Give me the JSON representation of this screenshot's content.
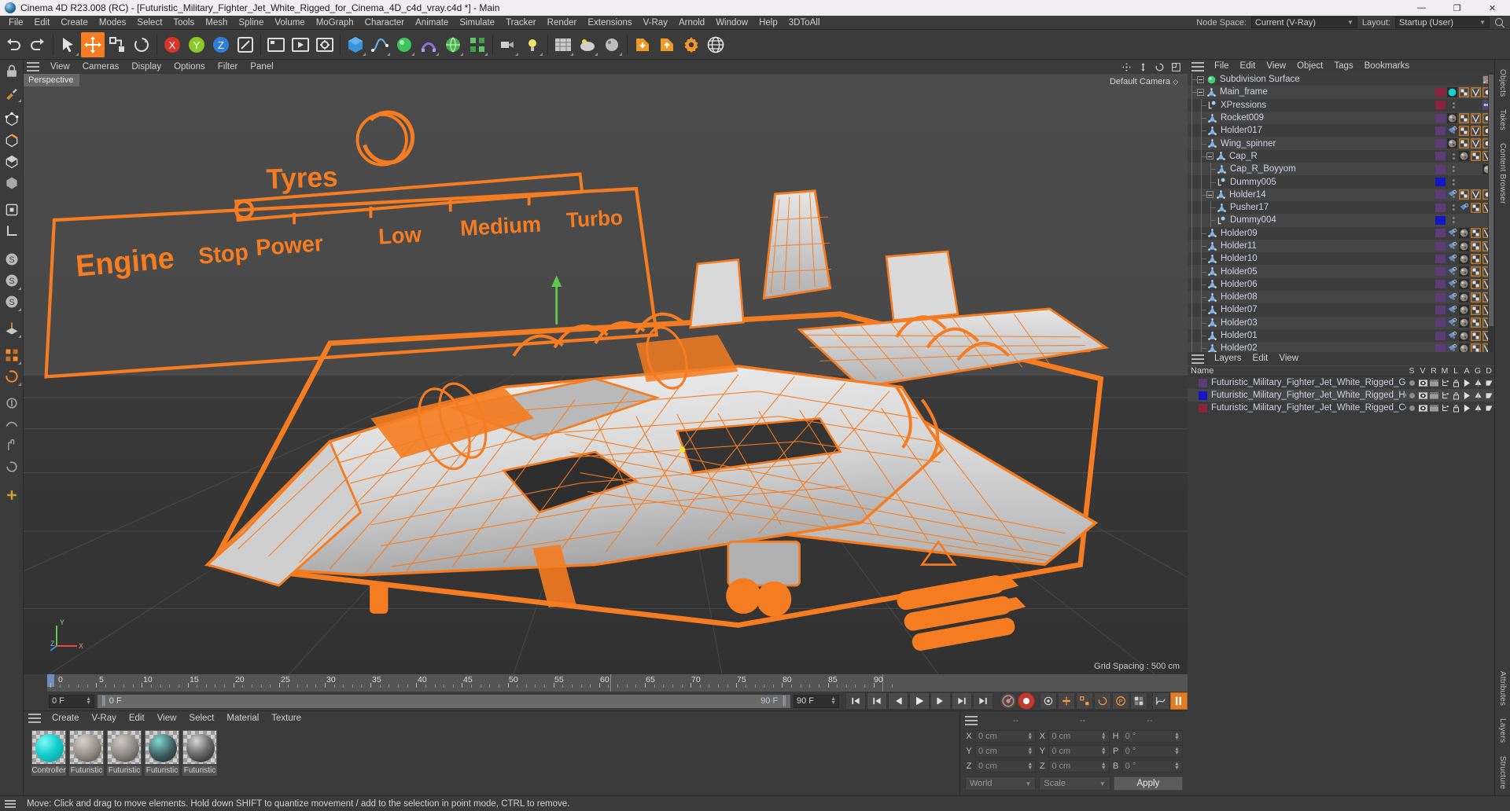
{
  "window": {
    "title": "Cinema 4D R23.008 (RC) - [Futuristic_Military_Fighter_Jet_White_Rigged_for_Cinema_4D_c4d_vray.c4d *] - Main",
    "minimize": "—",
    "maximize": "❐",
    "close": "✕"
  },
  "menubar": {
    "items": [
      "File",
      "Edit",
      "Create",
      "Modes",
      "Select",
      "Tools",
      "Mesh",
      "Spline",
      "Volume",
      "MoGraph",
      "Character",
      "Animate",
      "Simulate",
      "Tracker",
      "Render",
      "Extensions",
      "V-Ray",
      "Arnold",
      "Window",
      "Help",
      "3DToAll"
    ],
    "node_space_label": "Node Space:",
    "node_space_value": "Current (V-Ray)",
    "layout_label": "Layout:",
    "layout_value": "Startup (User)"
  },
  "viewport": {
    "menu": [
      "View",
      "Cameras",
      "Display",
      "Options",
      "Filter",
      "Panel"
    ],
    "perspective_label": "Perspective",
    "camera_label": "Default Camera",
    "grid_spacing": "Grid Spacing : 500 cm",
    "hud": {
      "tyres": "Tyres",
      "engine": "Engine",
      "stop": "Stop",
      "power": "Power",
      "low": "Low",
      "medium": "Medium",
      "turbo": "Turbo"
    },
    "axis": {
      "x": "X",
      "y": "Y",
      "z": "Z"
    }
  },
  "timeline": {
    "labels": [
      "0",
      "5",
      "10",
      "15",
      "20",
      "25",
      "30",
      "35",
      "40",
      "45",
      "50",
      "55",
      "60",
      "65",
      "70",
      "75",
      "80",
      "85",
      "90"
    ],
    "current_frame": "0 F",
    "preview_start": "0 F",
    "preview_end": "90 F",
    "end_frame": "90 F",
    "right_frame": "0 F"
  },
  "materials": {
    "menu": [
      "Create",
      "V-Ray",
      "Edit",
      "View",
      "Select",
      "Material",
      "Texture"
    ],
    "items": [
      {
        "name": "Controller",
        "color": "#19d3d3"
      },
      {
        "name": "Futuristic",
        "color": "#9a9289"
      },
      {
        "name": "Futuristic",
        "color": "#8e8b86"
      },
      {
        "name": "Futuristic",
        "color": "#4b5a5c"
      },
      {
        "name": "Futuristic",
        "color": "#6f6f6f"
      }
    ]
  },
  "coordinates": {
    "header_dashes": [
      "--",
      "--",
      "--"
    ],
    "rows": [
      {
        "pos_label": "X",
        "pos_value": "0 cm",
        "size_label": "X",
        "size_value": "0 cm",
        "rot_label": "H",
        "rot_value": "0 °"
      },
      {
        "pos_label": "Y",
        "pos_value": "0 cm",
        "size_label": "Y",
        "size_value": "0 cm",
        "rot_label": "P",
        "rot_value": "0 °"
      },
      {
        "pos_label": "Z",
        "pos_value": "0 cm",
        "size_label": "Z",
        "size_value": "0 cm",
        "rot_label": "B",
        "rot_value": "0 °"
      }
    ],
    "system": "World",
    "mode": "Scale",
    "apply": "Apply"
  },
  "object_manager": {
    "menu": [
      "File",
      "Edit",
      "View",
      "Object",
      "Tags",
      "Bookmarks"
    ],
    "items": [
      {
        "name": "Subdivision Surface",
        "depth": 0,
        "icon": "subdiv",
        "expandable": true,
        "color": null,
        "tags": [
          "display"
        ],
        "closable": true
      },
      {
        "name": "Main_frame",
        "depth": 1,
        "icon": "null",
        "expandable": true,
        "color": "#8b2340",
        "tags": [
          "mat-teal",
          "xpr-a",
          "xpr-b",
          "xpr-c"
        ]
      },
      {
        "name": "XPressions",
        "depth": 2,
        "icon": "xpresso",
        "expandable": false,
        "color": "#8b2340",
        "tags": [
          "xpresso"
        ]
      },
      {
        "name": "Rocket009",
        "depth": 2,
        "icon": "null",
        "expandable": false,
        "color": "#5b3b78",
        "tags": [
          "mat-rock",
          "xpr-a",
          "xpr-b",
          "xpr-c"
        ]
      },
      {
        "name": "Holder017",
        "depth": 2,
        "icon": "null",
        "expandable": false,
        "color": "#5b3b78",
        "tags": [
          "protect",
          "xpr-a",
          "xpr-b",
          "xpr-c"
        ]
      },
      {
        "name": "Wing_spinner",
        "depth": 2,
        "icon": "null",
        "expandable": false,
        "color": "#5b3b78",
        "tags": [
          "mat-rock",
          "xpr-a",
          "xpr-b",
          "xpr-c"
        ]
      },
      {
        "name": "Cap_R",
        "depth": 2,
        "icon": "null",
        "expandable": true,
        "color": "#5b3b78",
        "tags": [
          "mat-rock",
          "xpr-a",
          "xpr-b"
        ]
      },
      {
        "name": "Cap_R_Boyyom",
        "depth": 3,
        "icon": "null",
        "expandable": false,
        "color": "#5b3b78",
        "tags": [
          "mat-rock"
        ]
      },
      {
        "name": "Dummy005",
        "depth": 3,
        "icon": "xpresso",
        "expandable": false,
        "color": "#1414c8",
        "tags": []
      },
      {
        "name": "Holder14",
        "depth": 2,
        "icon": "null",
        "expandable": true,
        "color": "#5b3b78",
        "tags": [
          "protect",
          "xpr-a",
          "xpr-b",
          "xpr-c"
        ]
      },
      {
        "name": "Pusher17",
        "depth": 3,
        "icon": "null",
        "expandable": false,
        "color": "#5b3b78",
        "tags": [
          "protect",
          "xpr-a",
          "xpr-b"
        ]
      },
      {
        "name": "Dummy004",
        "depth": 3,
        "icon": "xpresso",
        "expandable": false,
        "color": "#1414c8",
        "tags": []
      },
      {
        "name": "Holder09",
        "depth": 2,
        "icon": "null",
        "expandable": false,
        "color": "#5b3b78",
        "tags": [
          "protect",
          "mat-rock",
          "xpr-a",
          "xpr-b"
        ]
      },
      {
        "name": "Holder11",
        "depth": 2,
        "icon": "null",
        "expandable": false,
        "color": "#5b3b78",
        "tags": [
          "protect",
          "mat-rock",
          "xpr-a",
          "xpr-b"
        ]
      },
      {
        "name": "Holder10",
        "depth": 2,
        "icon": "null",
        "expandable": false,
        "color": "#5b3b78",
        "tags": [
          "protect",
          "mat-rock",
          "xpr-a",
          "xpr-b"
        ]
      },
      {
        "name": "Holder05",
        "depth": 2,
        "icon": "null",
        "expandable": false,
        "color": "#5b3b78",
        "tags": [
          "protect",
          "mat-rock",
          "xpr-a",
          "xpr-b"
        ]
      },
      {
        "name": "Holder06",
        "depth": 2,
        "icon": "null",
        "expandable": false,
        "color": "#5b3b78",
        "tags": [
          "protect",
          "mat-rock",
          "xpr-a",
          "xpr-b"
        ]
      },
      {
        "name": "Holder08",
        "depth": 2,
        "icon": "null",
        "expandable": false,
        "color": "#5b3b78",
        "tags": [
          "protect",
          "mat-rock",
          "xpr-a",
          "xpr-b"
        ]
      },
      {
        "name": "Holder07",
        "depth": 2,
        "icon": "null",
        "expandable": false,
        "color": "#5b3b78",
        "tags": [
          "protect",
          "mat-rock",
          "xpr-a",
          "xpr-b"
        ]
      },
      {
        "name": "Holder03",
        "depth": 2,
        "icon": "null",
        "expandable": false,
        "color": "#5b3b78",
        "tags": [
          "protect",
          "mat-rock",
          "xpr-a",
          "xpr-b"
        ]
      },
      {
        "name": "Holder01",
        "depth": 2,
        "icon": "null",
        "expandable": false,
        "color": "#5b3b78",
        "tags": [
          "protect",
          "mat-rock",
          "xpr-a",
          "xpr-b"
        ]
      },
      {
        "name": "Holder02",
        "depth": 2,
        "icon": "null",
        "expandable": false,
        "color": "#5b3b78",
        "tags": [
          "protect",
          "mat-rock",
          "xpr-a",
          "xpr-b"
        ]
      }
    ]
  },
  "layer_manager": {
    "menu": [
      "Layers",
      "Edit",
      "View"
    ],
    "name_column": "Name",
    "columns": [
      "S",
      "V",
      "R",
      "M",
      "L",
      "A",
      "G",
      "D"
    ],
    "items": [
      {
        "name": "Futuristic_Military_Fighter_Jet_White_Rigged_Geometry",
        "color": "#5b3b78"
      },
      {
        "name": "Futuristic_Military_Fighter_Jet_White_Rigged_Helpers",
        "color": "#1414c8"
      },
      {
        "name": "Futuristic_Military_Fighter_Jet_White_Rigged_Controllers",
        "color": "#8b2340"
      }
    ]
  },
  "right_tabs": [
    "Objects",
    "Takes",
    "Content Browser",
    "Attributes",
    "Layers",
    "Structure"
  ],
  "statusbar": {
    "message": "Move: Click and drag to move elements. Hold down SHIFT to quantize movement / add to the selection in point mode, CTRL to remove."
  },
  "colors": {
    "accent_orange": "#f57c20",
    "panel_bg": "#3b3b3b",
    "row_alt": "#454545",
    "text": "#cdd6e0"
  }
}
